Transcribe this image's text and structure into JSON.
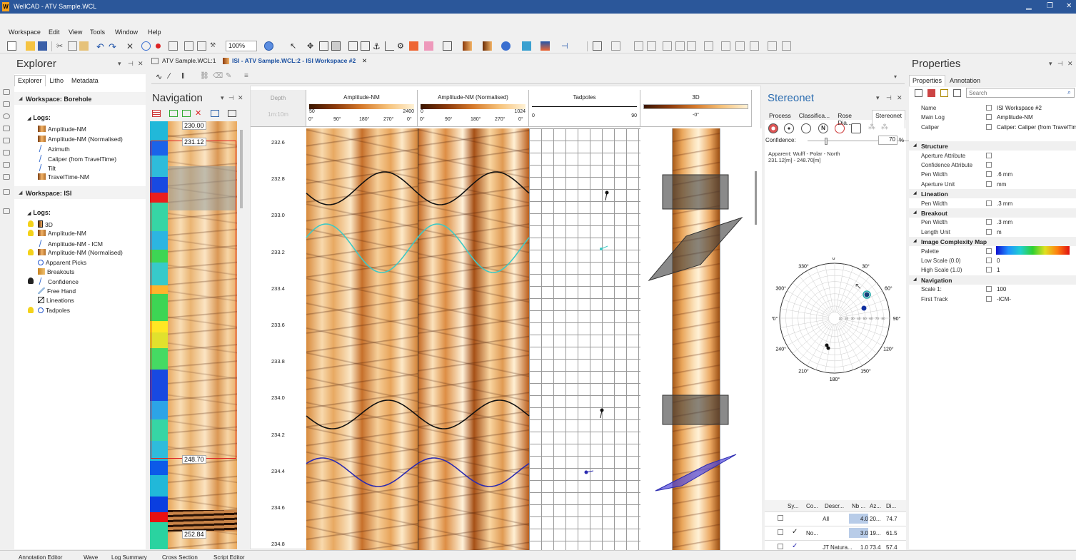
{
  "titlebar": {
    "app_title": "WellCAD - ATV Sample.WCL",
    "logo_letter": "W"
  },
  "menu": [
    "Workspace",
    "Edit",
    "View",
    "Tools",
    "Window",
    "Help"
  ],
  "toolbar": {
    "zoom": "100%"
  },
  "doc_tabs": [
    {
      "label": "ATV Sample.WCL:1",
      "active": false
    },
    {
      "label": "ISI - ATV Sample.WCL:2 - ISI Workspace #2",
      "active": true
    }
  ],
  "explorer": {
    "title": "Explorer",
    "tabs": [
      "Explorer",
      "Litho",
      "Metadata"
    ],
    "workspace_borehole": "Workspace: Borehole",
    "logs_label": "Logs:",
    "borehole_logs": [
      "Amplitude-NM",
      "Amplitude-NM (Normalised)",
      "Azimuth",
      "Caliper (from TravelTime)",
      "Tilt",
      "TravelTime-NM"
    ],
    "workspace_isi": "Workspace: ISI",
    "isi_logs": [
      "3D",
      "Amplitude-NM",
      "Amplitude-NM - ICM",
      "Amplitude-NM (Normalised)",
      "Apparent Picks",
      "Breakouts",
      "Confidence",
      "Free Hand",
      "Lineations",
      "Tadpoles"
    ]
  },
  "navigation": {
    "title": "Navigation",
    "marks": [
      "230.00",
      "231.12",
      "248.70",
      "252.84"
    ]
  },
  "tracks": {
    "depth_header": "Depth",
    "depth_unit": "1m:10m",
    "depths": [
      "232.6",
      "232.8",
      "233.0",
      "233.2",
      "233.4",
      "233.6",
      "233.8",
      "234.0",
      "234.2",
      "234.4",
      "234.6",
      "234.8"
    ],
    "amp": {
      "title": "Amplitude-NM",
      "min": "50",
      "max": "2400"
    },
    "ampn": {
      "title": "Amplitude-NM (Normalised)",
      "min": "0",
      "max": "1024"
    },
    "tad": {
      "title": "Tadpoles",
      "min": "0",
      "max": "90"
    },
    "d3": {
      "title": "3D",
      "angle": "-0°"
    },
    "angles": [
      "0°",
      "90°",
      "180°",
      "270°",
      "0°"
    ]
  },
  "stereonet": {
    "title": "Stereonet",
    "tabs": [
      "Process",
      "Classifica...",
      "Rose Dia...",
      "Stereonet"
    ],
    "confidence_label": "Confidence:",
    "confidence_value": "70",
    "confidence_unit": "%",
    "projection": "Apparent: Wulff - Polar - North",
    "range": "231.12[m] - 248.70[m]",
    "compass": [
      "0°",
      "30°",
      "60°",
      "90°",
      "120°",
      "150°",
      "180°",
      "210°",
      "240°",
      "270°",
      "300°",
      "330°"
    ],
    "table_header": [
      "Sy...",
      "Co...",
      "Descr...",
      "Nb ...",
      "Az...",
      "Di..."
    ],
    "rows": [
      {
        "co": "All",
        "descr": "",
        "nb": "4.0",
        "az": "20...",
        "di": "74.7"
      },
      {
        "co": "No...",
        "descr": "",
        "nb": "3.0",
        "az": "19...",
        "di": "61.5"
      },
      {
        "co": "JT",
        "descr": "Natura...",
        "nb": "1.0",
        "az": "73.4",
        "di": "57.4"
      }
    ]
  },
  "properties": {
    "title": "Properties",
    "tabs": [
      "Properties",
      "Annotation"
    ],
    "search_placeholder": "Search",
    "general": [
      {
        "k": "Name",
        "v": "ISI Workspace #2"
      },
      {
        "k": "Main Log",
        "v": "Amplitude-NM"
      },
      {
        "k": "Caliper",
        "v": "Caliper: Caliper (from TravelTime) [mm]"
      }
    ],
    "sections": [
      {
        "title": "Structure",
        "rows": [
          {
            "k": "Aperture Attribute",
            "v": ""
          },
          {
            "k": "Confidence Attribute",
            "v": ""
          },
          {
            "k": "Pen Width",
            "v": ".6 mm"
          },
          {
            "k": "Aperture Unit",
            "v": "mm"
          }
        ]
      },
      {
        "title": "Lineation",
        "rows": [
          {
            "k": "Pen Width",
            "v": ".3 mm"
          }
        ]
      },
      {
        "title": "Breakout",
        "rows": [
          {
            "k": "Pen Width",
            "v": ".3 mm"
          },
          {
            "k": "Length Unit",
            "v": "m"
          }
        ]
      },
      {
        "title": "Image Complexity Map",
        "rows": [
          {
            "k": "Palette",
            "v": ""
          },
          {
            "k": "Low Scale (0.0)",
            "v": "0"
          },
          {
            "k": "High Scale (1.0)",
            "v": "1"
          }
        ]
      },
      {
        "title": "Navigation",
        "rows": [
          {
            "k": "Scale 1:",
            "v": "100"
          },
          {
            "k": "First Track",
            "v": "-ICM-"
          }
        ]
      }
    ]
  },
  "statusbar": [
    "Annotation Editor",
    "Wave",
    "Log Summary",
    "Cross Section",
    "Script Editor"
  ]
}
